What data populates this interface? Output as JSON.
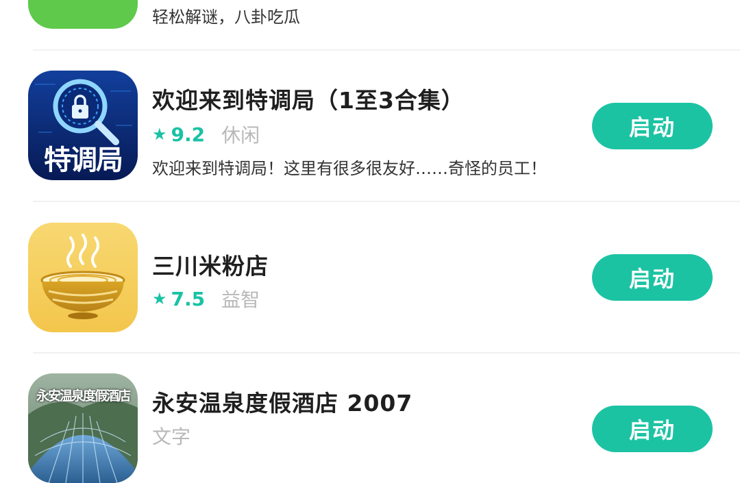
{
  "partial_top": {
    "desc": "轻松解谜，八卦吃瓜",
    "icon_color": "#5fc94b"
  },
  "apps": [
    {
      "name": "欢迎来到特调局（1至3合集）",
      "rating": "9.2",
      "category": "休闲",
      "desc": "欢迎来到特调局！这里有很多很友好……奇怪的员工！",
      "button": "启动",
      "icon": "magnifier-lock-icon",
      "icon_text": "特调局"
    },
    {
      "name": "三川米粉店",
      "rating": "7.5",
      "category": "益智",
      "button": "启动",
      "icon": "noodle-bowl-icon"
    },
    {
      "name": "永安温泉度假酒店 2007",
      "category": "文字",
      "button": "启动",
      "icon": "hotel-building-icon",
      "icon_text": "永安温泉度假酒店"
    }
  ],
  "colors": {
    "accent": "#1cc3a3",
    "rating": "#19c2a4",
    "category": "#b8b8b8"
  }
}
